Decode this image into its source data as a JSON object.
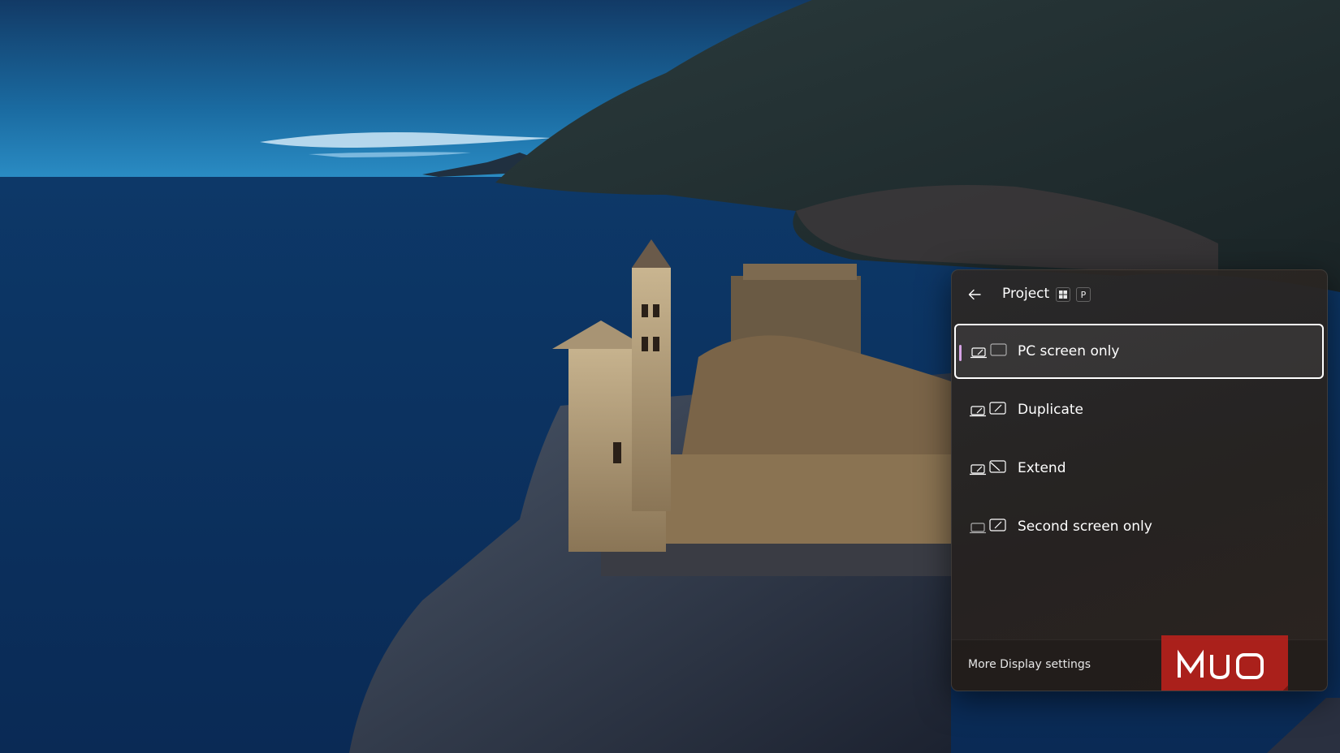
{
  "flyout": {
    "title": "Project",
    "shortcut": {
      "win_key": "windows-logo-key",
      "letter_key": "P"
    },
    "options": [
      {
        "label": "PC screen only",
        "icon": "pc-screen-only-icon",
        "selected": true
      },
      {
        "label": "Duplicate",
        "icon": "duplicate-icon",
        "selected": false
      },
      {
        "label": "Extend",
        "icon": "extend-icon",
        "selected": false
      },
      {
        "label": "Second screen only",
        "icon": "second-screen-only-icon",
        "selected": false
      }
    ],
    "footer_link": "More Display settings",
    "accent_color": "#d7a3e6"
  },
  "watermark": {
    "text": "MUO",
    "color": "#d6261f"
  }
}
